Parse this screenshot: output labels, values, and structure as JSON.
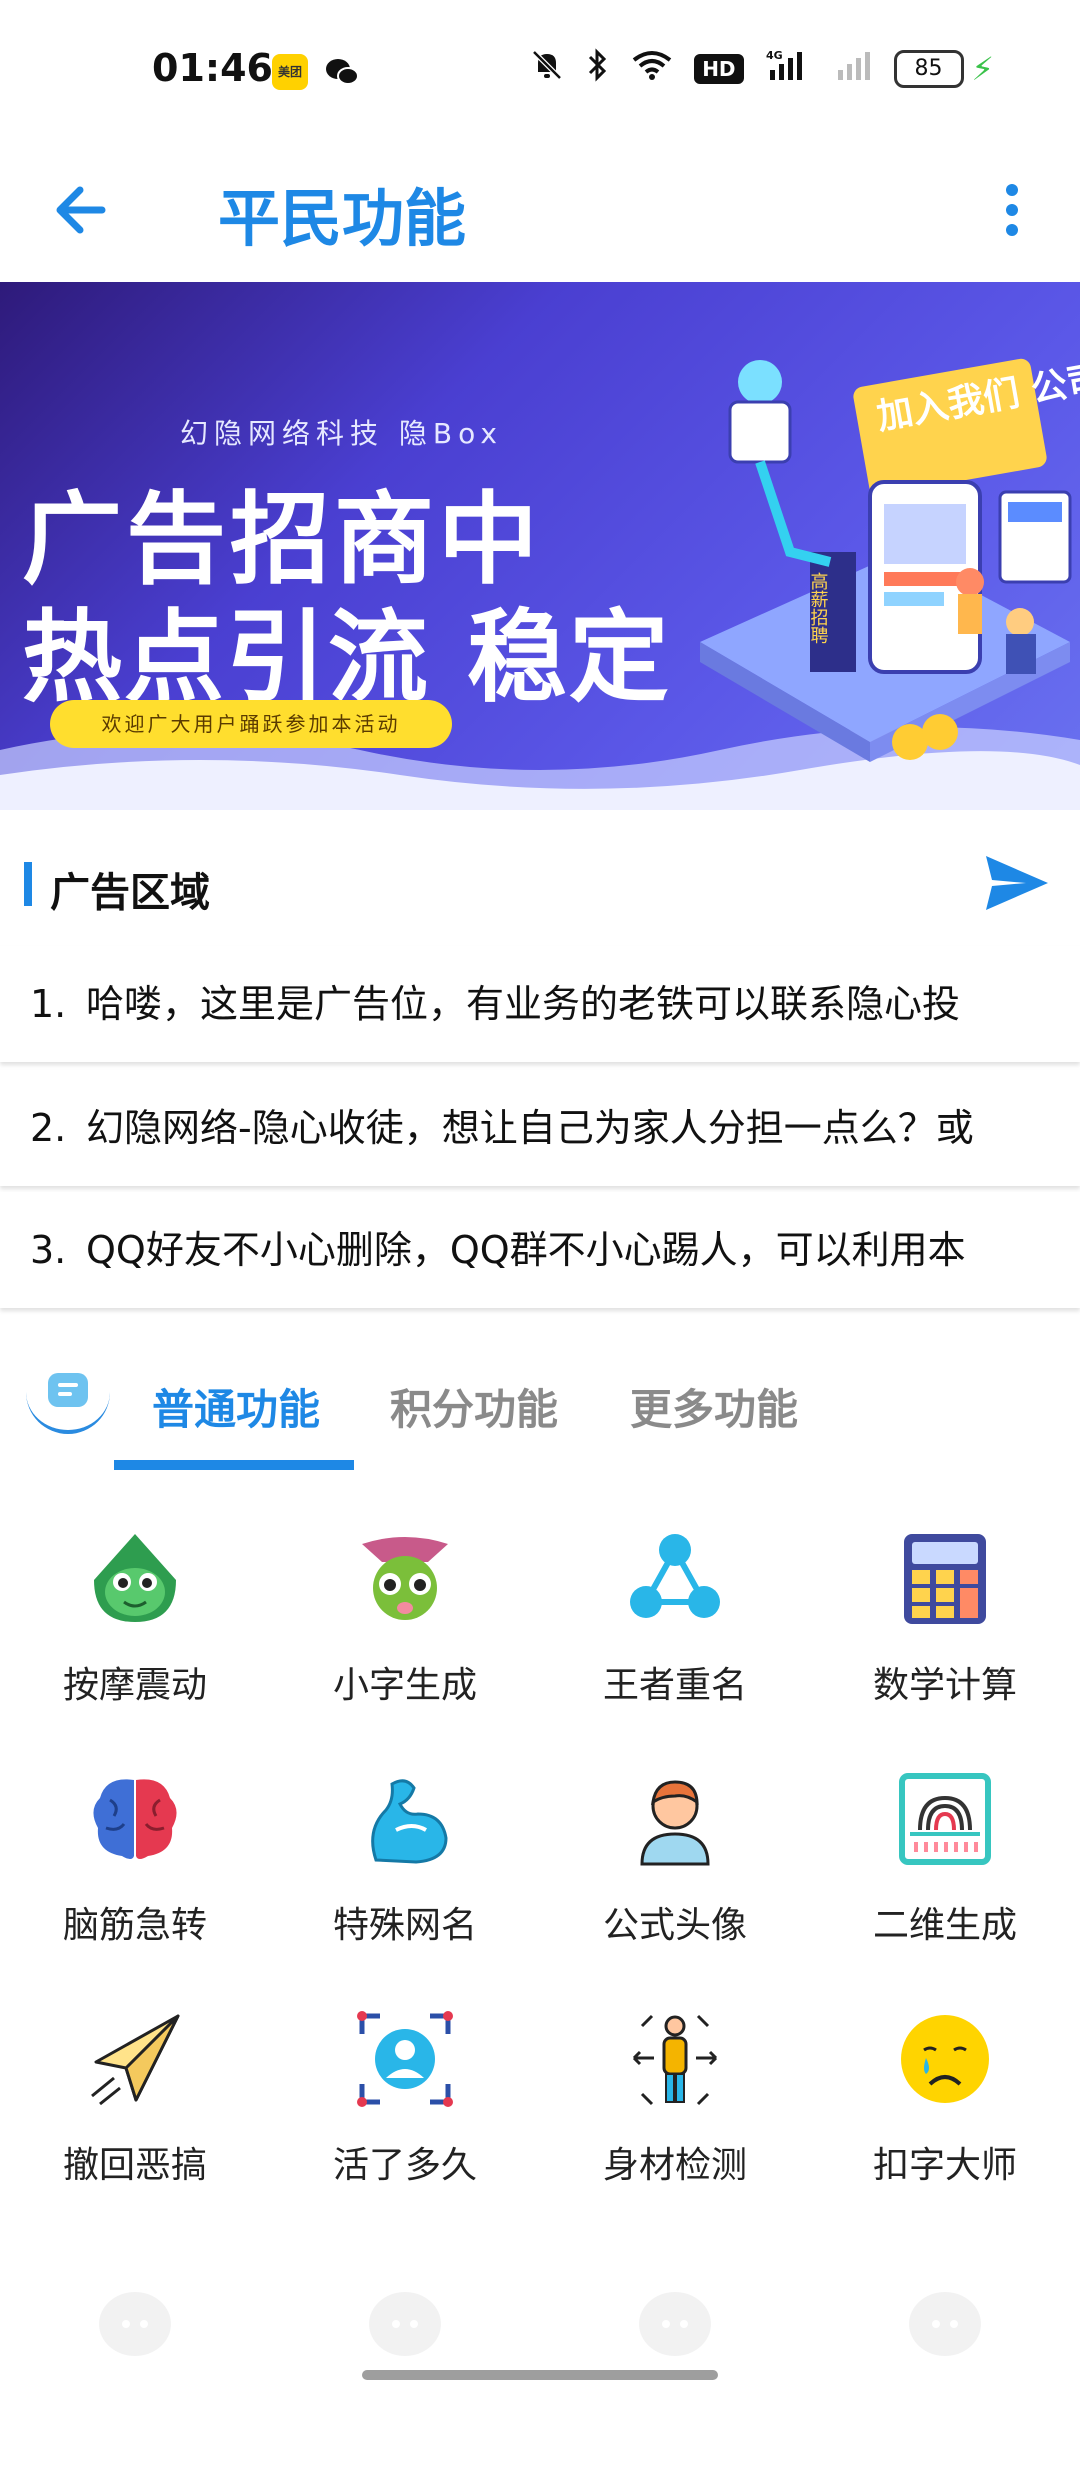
{
  "status_bar": {
    "time": "01:46",
    "app1": "美团",
    "network": "HD",
    "signal": "4G",
    "battery": "85"
  },
  "toolbar": {
    "title": "平民功能"
  },
  "banner": {
    "subtitle": "幻隐网络科技 隐Box",
    "line1": "广告招商中",
    "line2": "热点引流 稳定",
    "pill": "欢迎广大用户踊跃参加本活动",
    "art_sign": "加入我们 公司招聘",
    "art_side": "高薪招聘"
  },
  "ad": {
    "title": "广告区域",
    "items": [
      {
        "num": "1.",
        "text": "哈喽，这里是广告位，有业务的老铁可以联系隐心投"
      },
      {
        "num": "2.",
        "text": "幻隐网络-隐心收徒，想让自己为家人分担一点么？或"
      },
      {
        "num": "3.",
        "text": "QQ好友不小心删除，QQ群不小心踢人，可以利用本"
      }
    ]
  },
  "tabs": {
    "items": [
      "普通功能",
      "积分功能",
      "更多功能"
    ],
    "active_index": 0
  },
  "features": [
    {
      "label": "按摩震动",
      "icon": "frog-icon"
    },
    {
      "label": "小字生成",
      "icon": "alien-icon"
    },
    {
      "label": "王者重名",
      "icon": "share-nodes-icon"
    },
    {
      "label": "数学计算",
      "icon": "calculator-icon"
    },
    {
      "label": "脑筋急转",
      "icon": "brain-icon"
    },
    {
      "label": "特殊网名",
      "icon": "muscle-icon"
    },
    {
      "label": "公式头像",
      "icon": "person-avatar-icon"
    },
    {
      "label": "二维生成",
      "icon": "fingerprint-scan-icon"
    },
    {
      "label": "撤回恶搞",
      "icon": "paper-plane-icon"
    },
    {
      "label": "活了多久",
      "icon": "face-scan-icon"
    },
    {
      "label": "身材检测",
      "icon": "body-measure-icon"
    },
    {
      "label": "扣字大师",
      "icon": "sad-face-icon"
    }
  ],
  "colors": {
    "accent": "#1e88e5",
    "tab_inactive": "#8a8a8a",
    "banner": "#5b58e8"
  }
}
